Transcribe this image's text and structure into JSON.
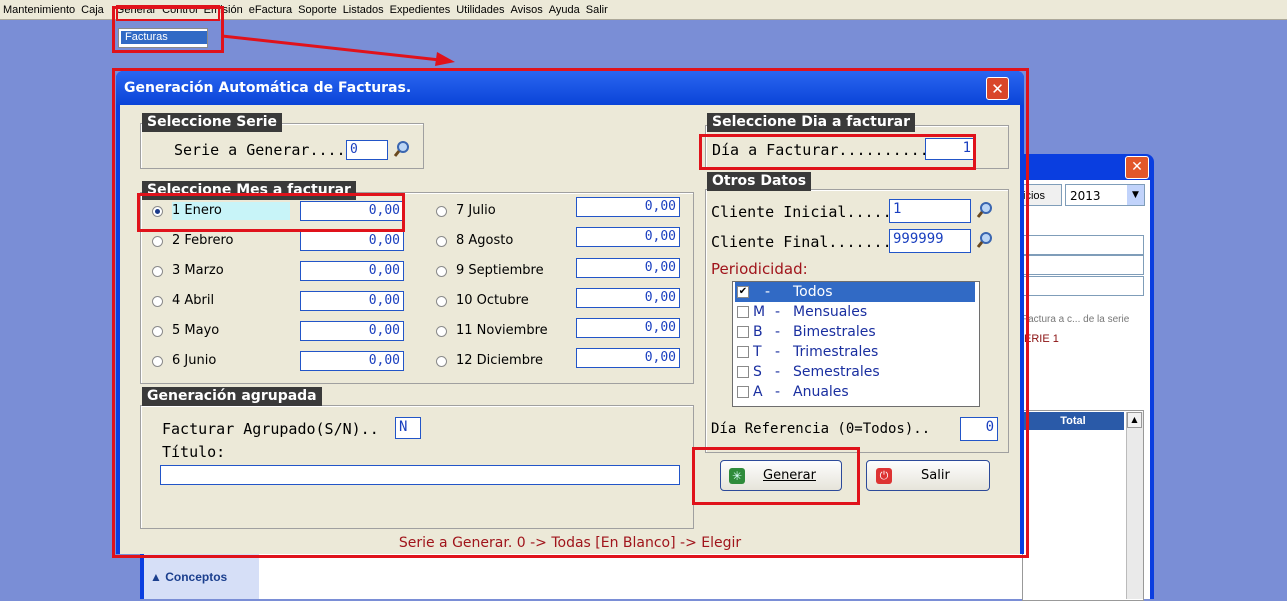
{
  "menubar": {
    "items": [
      "Mantenimiento",
      "Caja",
      "Generar",
      "Control",
      "Emisión",
      "eFactura",
      "Soporte",
      "Listados",
      "Expedientes",
      "Utilidades",
      "Avisos",
      "Ayuda",
      "Salir"
    ],
    "open_submenu_item": "Facturas"
  },
  "background_window": {
    "combo_label": "icios",
    "year": "2013",
    "group_label": "Factura a c... de la serie",
    "serie_text": "ERIE 1",
    "total_header": "Total",
    "sidebar_item": "Conceptos"
  },
  "dialog": {
    "title": "Generación Automática de Facturas.",
    "close_label": "✕",
    "serie": {
      "group_title": "Seleccione Serie",
      "label": "Serie a Generar....",
      "value": "0"
    },
    "mes": {
      "group_title": "Seleccione Mes a facturar",
      "months_left": [
        {
          "label": "1 Enero",
          "value": "0,00",
          "selected": true
        },
        {
          "label": "2 Febrero",
          "value": "0,00"
        },
        {
          "label": "3 Marzo",
          "value": "0,00"
        },
        {
          "label": "4 Abril",
          "value": "0,00"
        },
        {
          "label": "5 Mayo",
          "value": "0,00"
        },
        {
          "label": "6 Junio",
          "value": "0,00"
        }
      ],
      "months_right": [
        {
          "label": "7 Julio",
          "value": "0,00"
        },
        {
          "label": "8 Agosto",
          "value": "0,00"
        },
        {
          "label": "9 Septiembre",
          "value": "0,00"
        },
        {
          "label": "10 Octubre",
          "value": "0,00"
        },
        {
          "label": "11 Noviembre",
          "value": "0,00"
        },
        {
          "label": "12 Diciembre",
          "value": "0,00"
        }
      ]
    },
    "agrupada": {
      "group_title": "Generación agrupada",
      "label": "Facturar Agrupado(S/N)..",
      "value": "N",
      "titulo_label": "Título:",
      "titulo_value": ""
    },
    "dia": {
      "group_title": "Seleccione Dia a facturar",
      "label": "Día a Facturar..........",
      "value": "1"
    },
    "otros": {
      "group_title": "Otros Datos",
      "cliente_inicial_label": "Cliente Inicial........",
      "cliente_inicial_value": "1",
      "cliente_final_label": "Cliente Final..........",
      "cliente_final_value": "999999",
      "periodicidad_label": "Periodicidad:",
      "periodicidad": [
        {
          "code": "",
          "dash": "-",
          "name": "Todos",
          "checked": true,
          "selected": true
        },
        {
          "code": "M",
          "dash": "-",
          "name": "Mensuales",
          "checked": false
        },
        {
          "code": "B",
          "dash": "-",
          "name": "Bimestrales",
          "checked": false
        },
        {
          "code": "T",
          "dash": "-",
          "name": "Trimestrales",
          "checked": false
        },
        {
          "code": "S",
          "dash": "-",
          "name": "Semestrales",
          "checked": false
        },
        {
          "code": "A",
          "dash": "-",
          "name": "Anuales",
          "checked": false
        }
      ],
      "dia_referencia_label": "Día Referencia (0=Todos)..",
      "dia_referencia_value": "0"
    },
    "buttons": {
      "generar": "Generar",
      "salir": "Salir"
    },
    "status": "Serie a Generar. 0 -> Todas [En Blanco] -> Elegir"
  },
  "colors": {
    "highlight_red": "#e0121b",
    "title_blue": "#0a44d8",
    "selection_blue": "#316ac5"
  }
}
